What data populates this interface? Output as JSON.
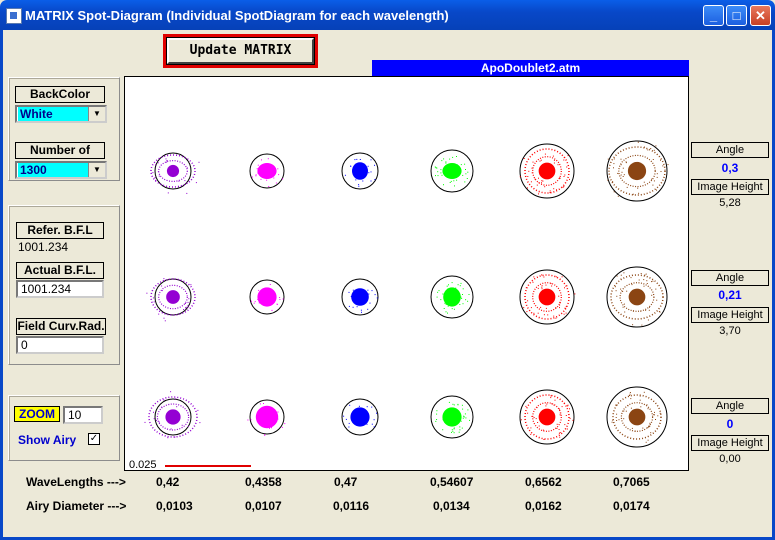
{
  "window": {
    "title": "MATRIX  Spot-Diagram (Individual SpotDiagram for each  wavelength)",
    "min": "_",
    "max": "□",
    "close": "✕"
  },
  "toolbar": {
    "update_label": "Update  MATRIX",
    "file_name": "ApoDoublet2.atm"
  },
  "settings": {
    "backcolor_label": "BackColor",
    "backcolor_value": "White",
    "rays_label": "Number of rays",
    "rays_value": "1300"
  },
  "bfl": {
    "refer_label": "Refer.  B.F.L",
    "refer_value": "1001.234",
    "actual_label": "Actual  B.F.L.",
    "actual_value": "1001.234",
    "curv_label": "Field Curv.Rad.",
    "curv_value": "0"
  },
  "zoom": {
    "label": "ZOOM",
    "value": "10",
    "show_airy_label": "Show Airy",
    "show_airy_checked": "✓"
  },
  "plot": {
    "scale_label": "0.025"
  },
  "fields": [
    {
      "angle_label": "Angle",
      "angle": "0,3",
      "height_label": "Image Height",
      "height": "5,28"
    },
    {
      "angle_label": "Angle",
      "angle": "0,21",
      "height_label": "Image Height",
      "height": "3,70"
    },
    {
      "angle_label": "Angle",
      "angle": "0",
      "height_label": "Image Height",
      "height": "0,00"
    }
  ],
  "bottom": {
    "wavelengths_label": "WaveLengths --->",
    "airy_label": "Airy Diameter --->",
    "wavelengths": [
      "0,42",
      "0,4358",
      "0,47",
      "0,54607",
      "0,6562",
      "0,7065"
    ],
    "airy": [
      "0,0103",
      "0,0107",
      "0,0116",
      "0,0134",
      "0,0162",
      "0,0174"
    ]
  },
  "spot_colors": [
    "#9400d3",
    "#ff00ff",
    "#0000ff",
    "#00ff00",
    "#ff0000",
    "#8b4513"
  ]
}
